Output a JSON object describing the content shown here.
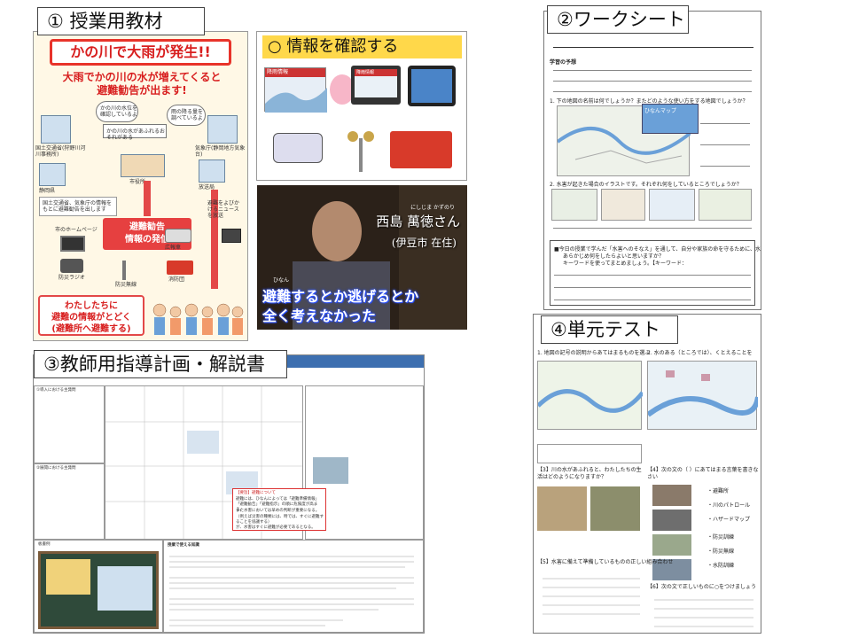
{
  "tags": {
    "material": "① 授業用教材",
    "worksheet": "②ワークシート",
    "plan": "③教師用指導計画・解説書",
    "test": "④単元テスト"
  },
  "material": {
    "banner": "かの川で大雨が発生!!",
    "subhead_1": "大雨でかの川の水が増えてくると",
    "subhead_2": "避難勧告が出ます!",
    "callout_1": "かの川の水位を確認しているよ",
    "callout_2": "雨の降る量を調べているよ",
    "callout_3": "かの川の水があふれるおそれがある",
    "label_kokudo": "国土交通省(狩野川河川事務所)",
    "label_kishocho": "気象庁(静岡地方気象台)",
    "label_pref": "静岡県",
    "label_city": "市役所",
    "label_tv": "放送局",
    "label_note": "国土交通省、気象庁の情報をもとに避難勧告を出します",
    "warning_1": "避難勧告",
    "warning_2": "情報の発信",
    "label_homepage": "市のホームページ",
    "label_radio": "防災ラジオ",
    "label_wireless": "防災無線",
    "label_car": "広報車",
    "label_fire": "消防団",
    "label_news": "避難をよびかけるニュースを放送",
    "bottom_1": "わたしたちに",
    "bottom_2": "避難の情報がとどく",
    "bottom_3": "(避難所へ避難する)"
  },
  "info": {
    "title": "○ 情報を確認する",
    "label_rain": "降雨情報",
    "label_river": "降雨情報"
  },
  "video": {
    "name": "西島 萬徳さん",
    "name_ruby": "にしじま かずのり",
    "place": "(伊豆市 在住)",
    "ruby_hinan": "ひなん",
    "subtitle_1": "避難するとか逃げるとか",
    "subtitle_2": "全く考えなかった"
  },
  "worksheet": {
    "q_head": "学習の予想",
    "q1": "1. 下の地図の名前は何でしょうか？またどのような使い方をする地図でしょうか？",
    "q2": "2. 水害が起きた場合のイラストです。それぞれ何をしているところでしょうか？",
    "q3a": "■今日の授業で学んだ「水害へのそなえ」を通して、自分や家族の命を守るために、水害にそなえて",
    "q3b": "あらかじめ何をしたらよいと思いますか？",
    "q3c": "キーワードを使ってまとめましょう。【キーワード：",
    "map_title": "ひなんマップ"
  },
  "plan": {
    "col_1": "①導入における主発問",
    "col_2": "②展開における主発問",
    "note_title": "【要旨】避難について",
    "note_1": "避難には、ひなんによっては「避難準備情報」「避難勧告」「避難指示」の順に危険度が高まる。",
    "note_2": "また水害においては早めの判断が重要になる。",
    "note_3": "（例えば災害の種類には、時では、すぐに避難することを協議する）",
    "note_4": "が、水害はすぐに避難が必要であるとなる。",
    "bottom_title": "授業で使える知識",
    "board_label": "板書例"
  },
  "test": {
    "q1": "1. 地図の記号の説明からあてはまるものを選ぶ",
    "q2": "2. 水のある（ところでは）、くとえることを",
    "q3": "【3】川の水があふれると、わたしたちの生活はどのようになりますか？",
    "q4": "【4】次の文の（ ）にあてはまる言葉を書きなさい",
    "q5": "【5】水害に備えて準備しているものの正しい組み合わせ",
    "q6": "【6】次の文で正しいものに○をつけましょう",
    "opt_1": "・避難所",
    "opt_2": "・川のパトロール",
    "opt_3": "・ハザードマップ",
    "opt_4": "・防災訓練",
    "opt_5": "・防災無線",
    "opt_6": "・水防訓練"
  }
}
